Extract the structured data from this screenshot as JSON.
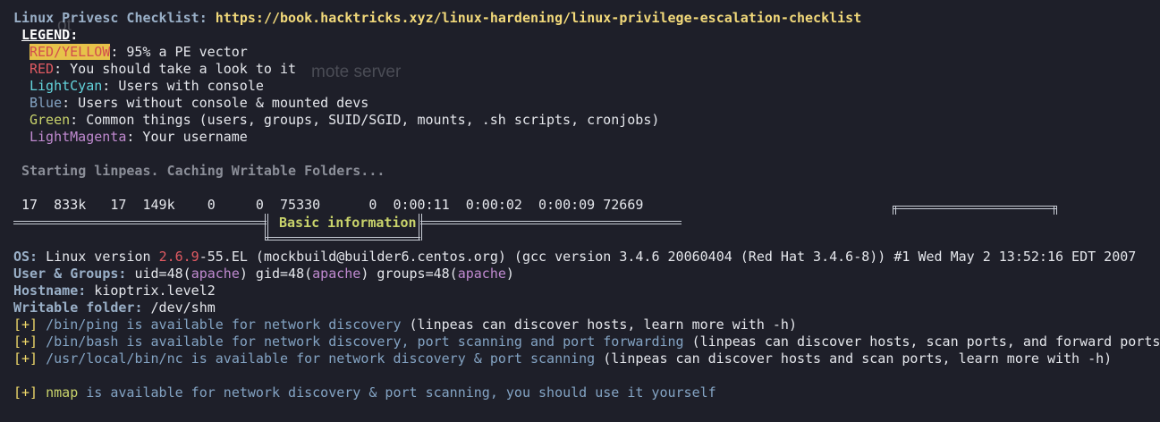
{
  "checklist": {
    "label": "Linux Privesc Checklist:",
    "url": "https://book.hacktricks.xyz/linux-hardening/linux-privilege-escalation-checklist"
  },
  "ghost_text": {
    "fragment_1": "ot",
    "fragment_2": "mote server"
  },
  "legend": {
    "title": "LEGEND",
    "colon": ":",
    "items": [
      {
        "name": "RED/YELLOW",
        "desc": ": 95% a PE vector",
        "color": "#e7c24a"
      },
      {
        "name": "RED",
        "desc": ": You should take a look to it",
        "color": "#e05a62"
      },
      {
        "name": "LightCyan",
        "desc": ": Users with console",
        "color": "#63d4dc"
      },
      {
        "name": "Blue",
        "desc": ": Users without console & mounted devs",
        "color": "#84a4c4"
      },
      {
        "name": "Green",
        "desc": ": Common things (users, groups, SUID/SGID, mounts, .sh scripts, cronjobs)",
        "color": "#c9d36b"
      },
      {
        "name": "LightMagenta",
        "desc": ": Your username",
        "color": "#c08ad0"
      }
    ]
  },
  "starting": "Starting linpeas. Caching Writable Folders...",
  "progress": {
    "text": " 17  833k   17  149k    0     0  75330      0  0:00:11  0:00:02  0:00:09 72669"
  },
  "section": {
    "title": "Basic information"
  },
  "os": {
    "label": "OS:",
    "pre": " Linux version ",
    "version": "2.6.9",
    "post": "-55.EL (mockbuild@builder6.centos.org) (gcc version 3.4.6 20060404 (Red Hat 3.4.6-8)) #1 Wed May 2 13:52:16 EDT 2007"
  },
  "users_groups": {
    "label": "User & Groups:",
    "p1": " uid=48(",
    "u1": "apache",
    "p2": ") gid=48(",
    "u2": "apache",
    "p3": ") groups=48(",
    "u3": "apache",
    "p4": ")"
  },
  "hostname": {
    "label": "Hostname:",
    "value": " kioptrix.level2"
  },
  "writable": {
    "label": "Writable folder:",
    "value": " /dev/shm"
  },
  "tools": [
    {
      "marker": "[+]",
      "a": " /bin/ping is available for network discovery",
      "b": "",
      "c": " (linpeas can discover hosts, learn more with -h)"
    },
    {
      "marker": "[+]",
      "a": " /bin/bash is available for network discovery",
      "b": ", port scanning and port forwarding",
      "c": " (linpeas can discover hosts, scan ports, and forward ports."
    },
    {
      "marker": "[+]",
      "a": " /usr/local/bin/nc is available for network discovery & port scanning",
      "b": "",
      "c": " (linpeas can discover hosts and scan ports, learn more with -h)"
    }
  ],
  "nmap": {
    "marker": "[+]",
    "text": " nmap",
    "rest": " is available for network discovery & port scanning, you should use it yourself"
  }
}
